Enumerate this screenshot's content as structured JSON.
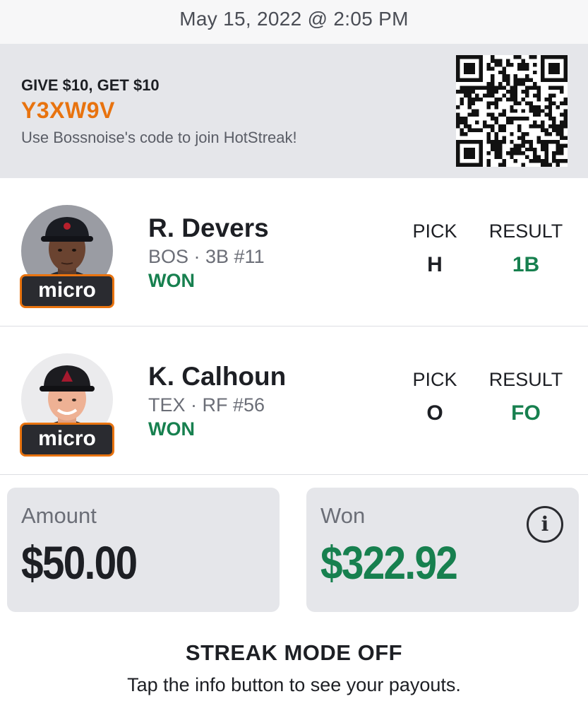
{
  "header": {
    "datetime": "May 15, 2022 @ 2:05 PM"
  },
  "referral": {
    "offer": "GIVE $10, GET $10",
    "code": "Y3XW9V",
    "message": "Use Bossnoise's code to join HotStreak!",
    "qr_icon": "qr-code-icon"
  },
  "players": [
    {
      "name": "R. Devers",
      "meta": "BOS · 3B #11",
      "status": "WON",
      "badge": "micro",
      "pick_label": "PICK",
      "pick": "H",
      "result_label": "RESULT",
      "result": "1B"
    },
    {
      "name": "K. Calhoun",
      "meta": "TEX · RF #56",
      "status": "WON",
      "badge": "micro",
      "pick_label": "PICK",
      "pick": "O",
      "result_label": "RESULT",
      "result": "FO"
    }
  ],
  "amount": {
    "label": "Amount",
    "value": "$50.00"
  },
  "won": {
    "label": "Won",
    "value": "$322.92",
    "info_icon": "info-icon"
  },
  "streak": {
    "title": "STREAK MODE OFF",
    "message": "Tap the info button to see your payouts."
  },
  "colors": {
    "accent_orange": "#e8730f",
    "win_green": "#17804f",
    "panel_gray": "#e5e6ea",
    "text_dark": "#1d1f24"
  }
}
